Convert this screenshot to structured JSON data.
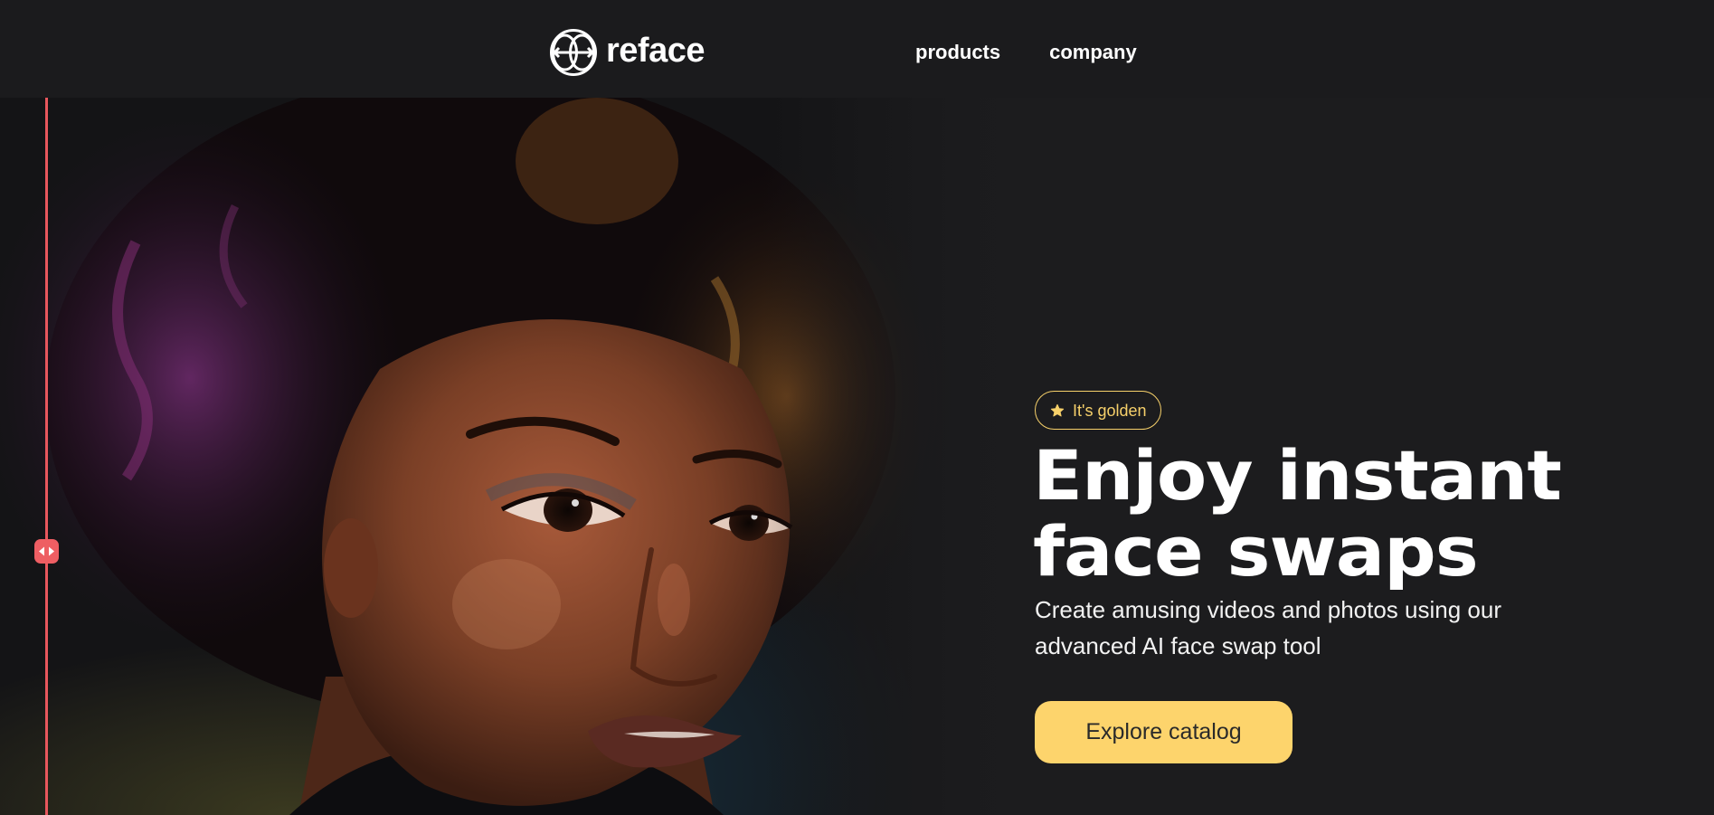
{
  "brand": {
    "name": "reface",
    "logo_icon": "reface-logo-icon"
  },
  "nav": {
    "items": [
      {
        "label": "products"
      },
      {
        "label": "company"
      }
    ]
  },
  "hero": {
    "badge": {
      "icon": "star-icon",
      "label": "It's golden"
    },
    "headline": {
      "line1": "Enjoy instant",
      "line2": "face swaps"
    },
    "subtitle": "Create amusing videos and photos using our advanced AI face swap tool",
    "cta_label": "Explore catalog",
    "compare_slider": {
      "icon": "arrows-left-right-icon",
      "position": 0.027
    }
  },
  "colors": {
    "background": "#1c1c1e",
    "accent": "#fdd46c",
    "badge": "#f6d06a",
    "slider": "#e8575d"
  }
}
